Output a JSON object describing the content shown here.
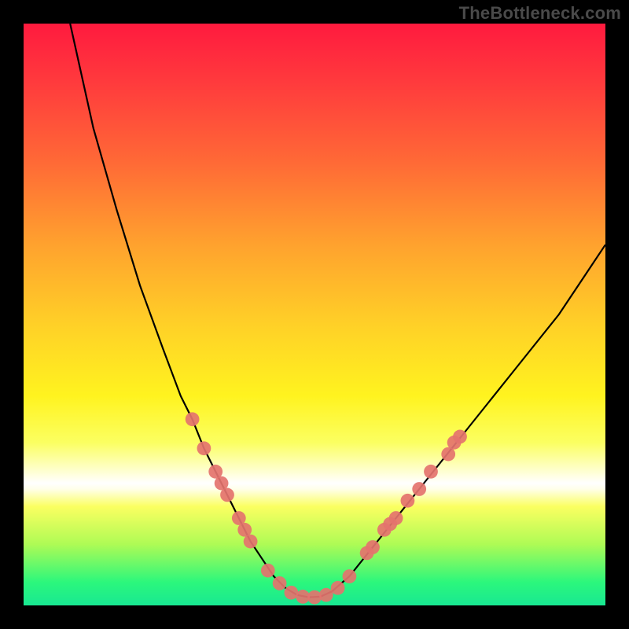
{
  "watermark": "TheBottleneck.com",
  "chart_data": {
    "type": "line",
    "title": "",
    "xlabel": "",
    "ylabel": "",
    "xlim": [
      0,
      100
    ],
    "ylim": [
      0,
      100
    ],
    "grid": false,
    "legend": false,
    "background_gradient": {
      "axis": "y",
      "stops": [
        {
          "pos": 0,
          "color": "#18e892"
        },
        {
          "pos": 4,
          "color": "#2cf77c"
        },
        {
          "pos": 10,
          "color": "#aefb55"
        },
        {
          "pos": 17,
          "color": "#fbff61"
        },
        {
          "pos": 21,
          "color": "#ffffff"
        },
        {
          "pos": 22,
          "color": "#ffffe9"
        },
        {
          "pos": 28,
          "color": "#fbff61"
        },
        {
          "pos": 36,
          "color": "#fff31f"
        },
        {
          "pos": 48,
          "color": "#ffd127"
        },
        {
          "pos": 62,
          "color": "#ffa22e"
        },
        {
          "pos": 76,
          "color": "#ff6a36"
        },
        {
          "pos": 90,
          "color": "#ff3a3d"
        },
        {
          "pos": 100,
          "color": "#ff1a3e"
        }
      ]
    },
    "series": [
      {
        "name": "curve",
        "x": [
          8,
          12,
          16,
          20,
          24,
          27,
          29,
          31,
          33,
          35,
          37,
          39,
          41,
          43,
          45,
          47,
          49,
          51,
          53,
          56,
          60,
          64,
          68,
          72,
          76,
          80,
          84,
          88,
          92,
          96,
          100
        ],
        "y": [
          100,
          82,
          68,
          55,
          44,
          36,
          32,
          27,
          23,
          19,
          15,
          11,
          8,
          5,
          3,
          1.8,
          1.4,
          1.5,
          2.4,
          5,
          10,
          15,
          20,
          25,
          30,
          35,
          40,
          45,
          50,
          56,
          62
        ]
      }
    ],
    "markers": {
      "name": "highlight-points",
      "color": "#e4736e",
      "radius": 1.2,
      "points": [
        {
          "x": 29,
          "y": 32
        },
        {
          "x": 31,
          "y": 27
        },
        {
          "x": 33,
          "y": 23
        },
        {
          "x": 34,
          "y": 21
        },
        {
          "x": 35,
          "y": 19
        },
        {
          "x": 37,
          "y": 15
        },
        {
          "x": 38,
          "y": 13
        },
        {
          "x": 39,
          "y": 11
        },
        {
          "x": 42,
          "y": 6
        },
        {
          "x": 44,
          "y": 3.8
        },
        {
          "x": 46,
          "y": 2.2
        },
        {
          "x": 48,
          "y": 1.5
        },
        {
          "x": 50,
          "y": 1.4
        },
        {
          "x": 52,
          "y": 1.8
        },
        {
          "x": 54,
          "y": 3
        },
        {
          "x": 56,
          "y": 5
        },
        {
          "x": 59,
          "y": 9
        },
        {
          "x": 60,
          "y": 10
        },
        {
          "x": 62,
          "y": 13
        },
        {
          "x": 63,
          "y": 14
        },
        {
          "x": 64,
          "y": 15
        },
        {
          "x": 66,
          "y": 18
        },
        {
          "x": 68,
          "y": 20
        },
        {
          "x": 70,
          "y": 23
        },
        {
          "x": 73,
          "y": 26
        },
        {
          "x": 74,
          "y": 28
        },
        {
          "x": 75,
          "y": 29
        }
      ]
    }
  }
}
